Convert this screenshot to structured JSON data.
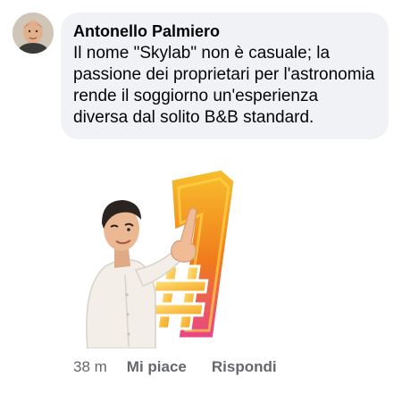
{
  "comment": {
    "author": "Antonello Palmiero",
    "text": "Il nome \"Skylab\" non è casuale; la passione dei proprietari per l'astronomia rende il soggiorno un'esperienza diversa dal solito B&B standard.",
    "avatar_icon": "profile-photo",
    "sticker": {
      "icon": "number-one-sticker",
      "badge_text": "#1"
    },
    "actions": {
      "time": "38 m",
      "like_label": "Mi piace",
      "reply_label": "Rispondi"
    }
  },
  "colors": {
    "bubble_bg": "#f0f2f5",
    "text": "#050505",
    "secondary_text": "#65676b",
    "sticker_orange": "#f08a1c",
    "sticker_pink": "#e8448a"
  }
}
